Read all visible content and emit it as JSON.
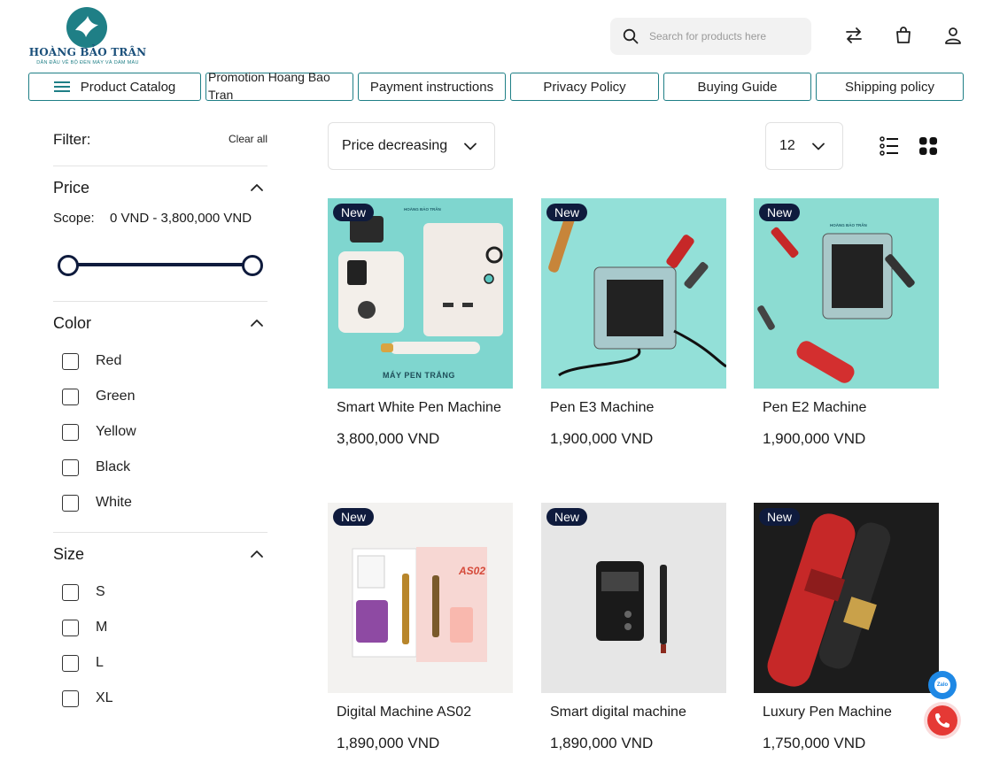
{
  "brand": {
    "name": "HOÀNG BẢO TRÂN",
    "tagline": "DẪN ĐẦU VỀ BỘ ĐÈN MÁY VÀ DÁM MÀU",
    "color": "#1f7f86"
  },
  "header": {
    "search_placeholder": "Search for products here",
    "icons": [
      "search-icon",
      "compare-icon",
      "bag-icon",
      "user-icon"
    ]
  },
  "nav": {
    "items": [
      {
        "label": "Product Catalog",
        "icon": "menu-icon"
      },
      {
        "label": "Promotion Hoang Bao Tran"
      },
      {
        "label": "Payment instructions"
      },
      {
        "label": "Privacy Policy"
      },
      {
        "label": "Buying Guide"
      },
      {
        "label": "Shipping policy"
      }
    ]
  },
  "filter": {
    "title": "Filter:",
    "clear_label": "Clear all",
    "price": {
      "title": "Price",
      "scope_label": "Scope:",
      "scope_value": "0 VND - 3,800,000 VND",
      "range_min": 0,
      "range_max": 1
    },
    "color": {
      "title": "Color",
      "options": [
        "Red",
        "Green",
        "Yellow",
        "Black",
        "White"
      ]
    },
    "size": {
      "title": "Size",
      "options": [
        "S",
        "M",
        "L",
        "XL"
      ]
    }
  },
  "toolbar": {
    "sort_value": "Price decreasing",
    "per_page_value": "12",
    "view_icons": [
      "list-view-icon",
      "grid-view-icon"
    ]
  },
  "products": [
    {
      "badge": "New",
      "name": "Smart White Pen Machine",
      "price": "3,800,000 VND",
      "img_caption": "MÁY PEN TRẮNG",
      "img_logo": "HOÀNG BẢO TRÂN"
    },
    {
      "badge": "New",
      "name": "Pen E3 Machine",
      "price": "1,900,000 VND"
    },
    {
      "badge": "New",
      "name": "Pen E2 Machine",
      "price": "1,900,000 VND",
      "img_logo": "HOÀNG BẢO TRÂN"
    },
    {
      "badge": "New",
      "name": "Digital Machine AS02",
      "price": "1,890,000 VND",
      "img_label": "AS02"
    },
    {
      "badge": "New",
      "name": "Smart digital machine",
      "price": "1,890,000 VND"
    },
    {
      "badge": "New",
      "name": "Luxury Pen Machine",
      "price": "1,750,000 VND"
    }
  ],
  "floating": {
    "zalo_label": "Zalo",
    "icons": [
      "zalo-icon",
      "phone-icon"
    ]
  },
  "colors": {
    "accent": "#1f7f86",
    "navy": "#0f1b3d",
    "teal_bg": "#7fd6cf",
    "call": "#e53935",
    "zalo": "#1e88e5"
  }
}
